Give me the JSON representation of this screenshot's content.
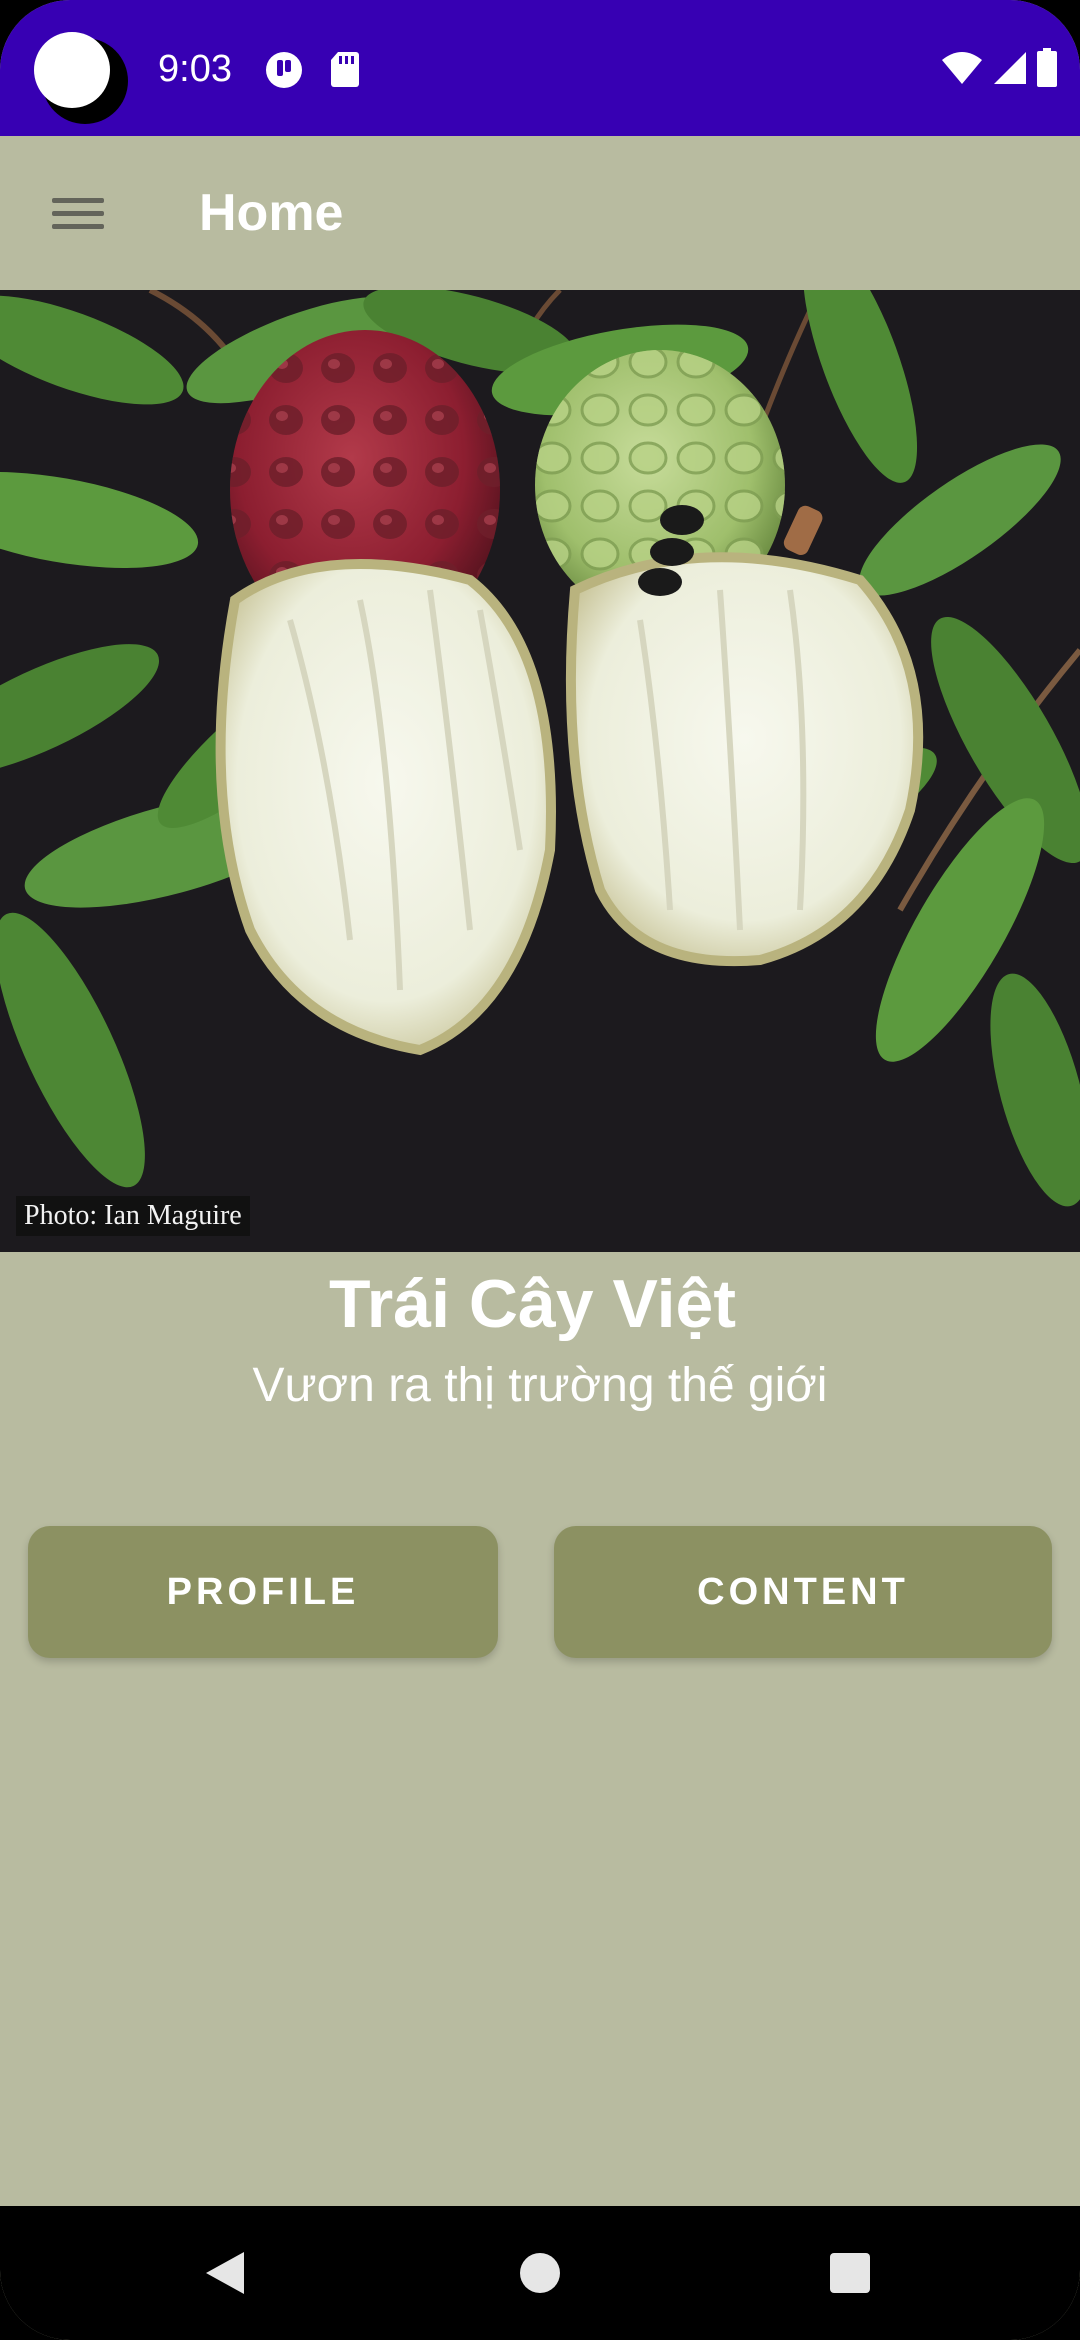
{
  "status_bar": {
    "time": "9:03",
    "icons": [
      "camera-cutout",
      "notification-icon",
      "sd-card-icon",
      "wifi-icon",
      "signal-icon",
      "battery-icon"
    ]
  },
  "app_bar": {
    "menu_icon": "menu-icon",
    "title": "Home"
  },
  "hero": {
    "photo_credit": "Photo: Ian Maguire",
    "subject": "custard-apple-fruits"
  },
  "main": {
    "headline": "Trái Cây Việt",
    "subline": "Vươn ra thị trường thế giới",
    "buttons": {
      "profile": "PROFILE",
      "content": "CONTENT"
    }
  },
  "nav_bar": {
    "back_icon": "back-triangle-icon",
    "home_icon": "home-circle-icon",
    "recent_icon": "recent-square-icon"
  },
  "colors": {
    "status_bar": "#3700b3",
    "background": "#b8bba0",
    "button": "#8c9162",
    "nav_bar": "#000000"
  }
}
